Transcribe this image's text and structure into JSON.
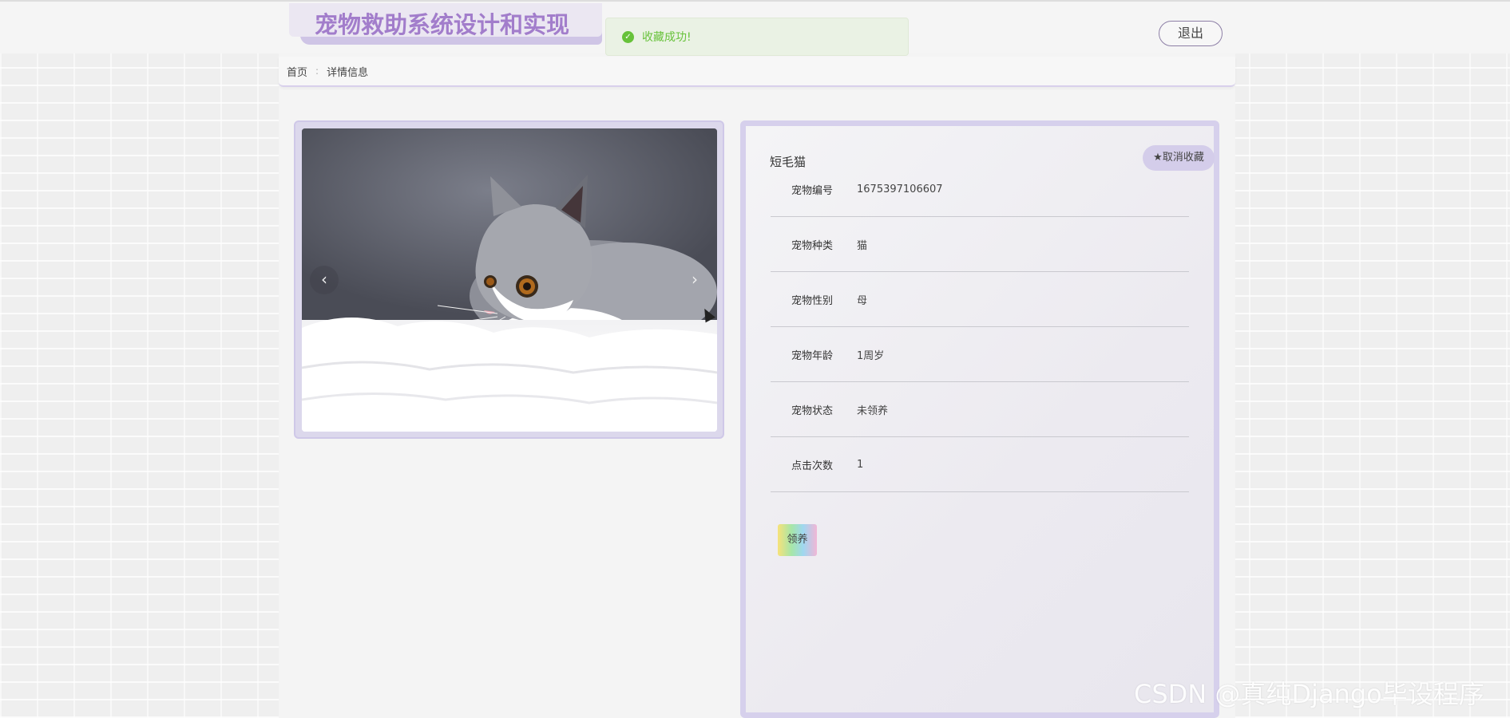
{
  "header": {
    "site_title": "宠物救助系统设计和实现",
    "logout_label": "退出"
  },
  "toast": {
    "message": "收藏成功!",
    "icon": "check-circle-icon"
  },
  "breadcrumb": {
    "home": "首页",
    "separator": ":",
    "current": "详情信息"
  },
  "gallery": {
    "prev_icon": "‹",
    "next_icon": "›"
  },
  "detail": {
    "title": "短毛猫",
    "unfavorite_label": "★取消收藏",
    "rows": [
      {
        "label": "宠物编号",
        "value": "1675397106607"
      },
      {
        "label": "宠物种类",
        "value": "猫"
      },
      {
        "label": "宠物性别",
        "value": "母"
      },
      {
        "label": "宠物年龄",
        "value": "1周岁"
      },
      {
        "label": "宠物状态",
        "value": "未领养"
      },
      {
        "label": "点击次数",
        "value": "1"
      }
    ],
    "adopt_label": "领养"
  },
  "watermark": "CSDN @真纯Django毕设程序",
  "colors": {
    "accent": "#a27dcb",
    "card_border": "#d6d0ec",
    "success": "#67c23a"
  }
}
